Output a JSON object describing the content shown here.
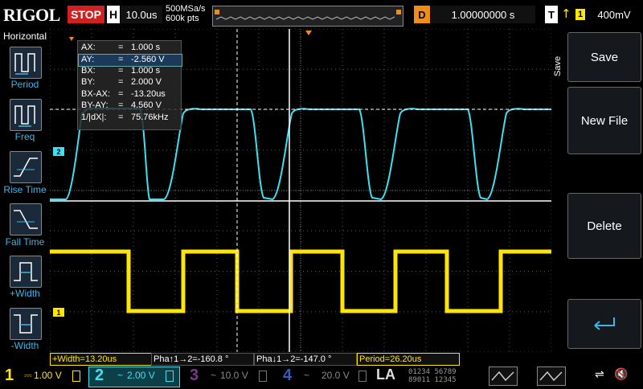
{
  "topbar": {
    "brand": "RIGOL",
    "run_state": "STOP",
    "horiz_label": "H",
    "timebase": "10.0us",
    "sample_rate": "500MSa/s",
    "memory_depth": "600k pts",
    "delay_label": "D",
    "delay_value": "1.00000000 s",
    "trigger_label": "T",
    "trigger_symbol": "↑",
    "trigger_channel": "1",
    "trigger_level": "400mV"
  },
  "left_menu": {
    "title": "Horizontal",
    "items": [
      {
        "label": "Period",
        "icon": "period-icon"
      },
      {
        "label": "Freq",
        "icon": "freq-icon"
      },
      {
        "label": "Rise Time",
        "icon": "rise-time-icon"
      },
      {
        "label": "Fall Time",
        "icon": "fall-time-icon"
      },
      {
        "label": "+Width",
        "icon": "plus-width-icon"
      },
      {
        "label": "-Width",
        "icon": "minus-width-icon"
      }
    ]
  },
  "right_menu": {
    "side_label": "Save",
    "buttons": [
      {
        "label": "Save"
      },
      {
        "label": "New File"
      },
      {
        "label": "Delete"
      },
      {
        "label": "",
        "icon": "return-icon"
      }
    ]
  },
  "cursor_readout": {
    "rows": [
      {
        "name": "AX:",
        "value": "1.000 s"
      },
      {
        "name": "AY:",
        "value": "-2.560 V"
      },
      {
        "name": "BX:",
        "value": "1.000 s"
      },
      {
        "name": "BY:",
        "value": "2.000 V"
      },
      {
        "name": "BX-AX:",
        "value": "-13.20us"
      },
      {
        "name": "BY-AY:",
        "value": "4.560 V"
      },
      {
        "name": "1/|dX|:",
        "value": "75.76kHz"
      }
    ],
    "selected_row": 1
  },
  "markers": {
    "ch2_marker": "2",
    "ch1_marker": "1",
    "trigger_marker": "T"
  },
  "measurements": [
    {
      "text": "+Width=13.20us",
      "color": "#ffe600"
    },
    {
      "text": "Pha↑1→2=-160.8 °",
      "color": "#ffffff"
    },
    {
      "text": "Pha↓1→2=-147.0 °",
      "color": "#ffffff"
    },
    {
      "text": "Period=26.20us",
      "color": "#ffe600"
    }
  ],
  "channels": [
    {
      "num": "1",
      "coupling": "⎓",
      "scale": "1.00 V",
      "color": "#ffe600",
      "active": true
    },
    {
      "num": "2",
      "coupling": "~",
      "scale": "2.00 V",
      "color": "#3fe0f0",
      "active": true
    },
    {
      "num": "3",
      "coupling": "~",
      "scale": "10.0 V",
      "color": "#b43cc8",
      "active": false
    },
    {
      "num": "4",
      "coupling": "~",
      "scale": "20.0 V",
      "color": "#3c5ab4",
      "active": false
    }
  ],
  "la": {
    "label": "LA",
    "bits_top": "01234 56789",
    "bits_bottom": "89011 12345"
  },
  "colors": {
    "ch1": "#ffe600",
    "ch2": "#3fe0f0",
    "accent_orange": "#f08c1a",
    "stop_red": "#d21f1f"
  }
}
